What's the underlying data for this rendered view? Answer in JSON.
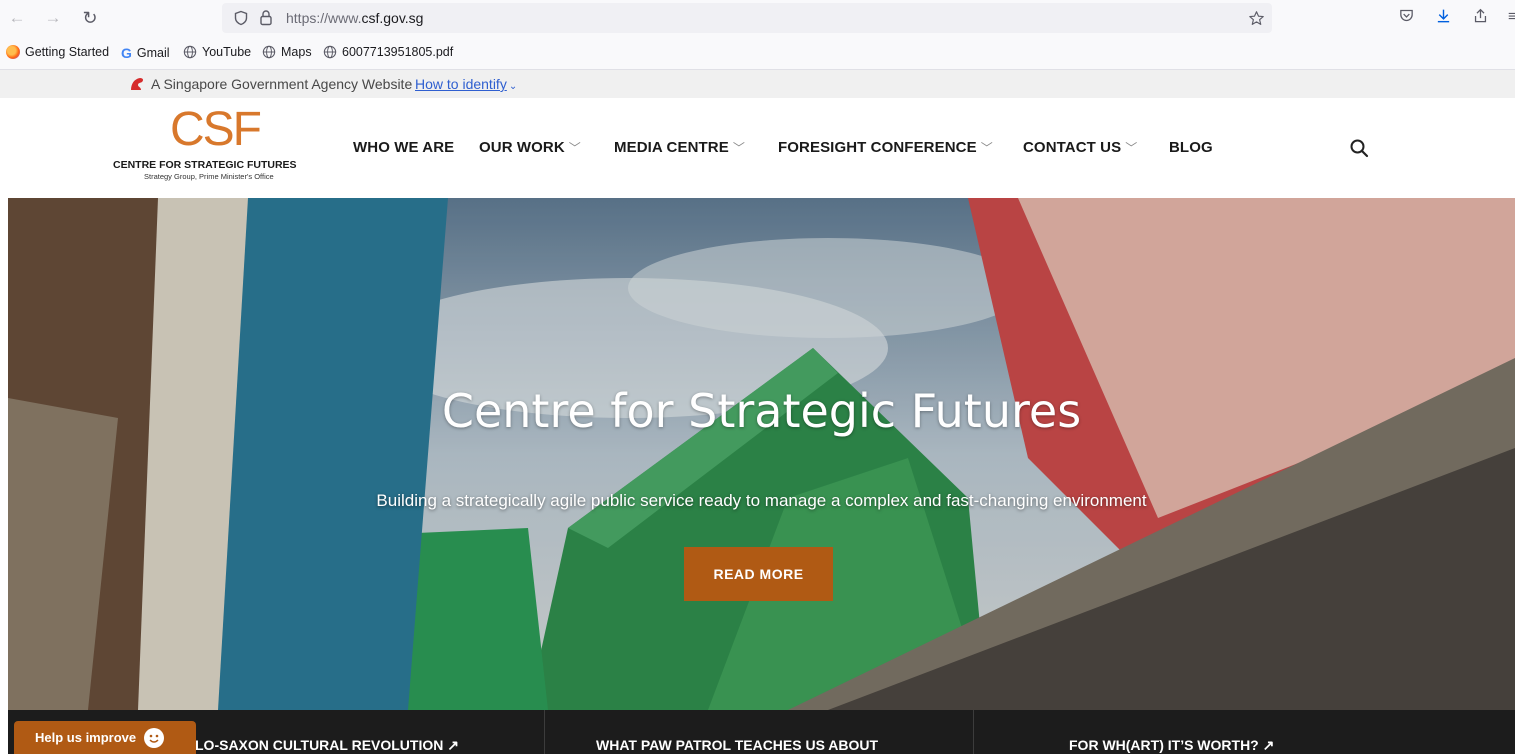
{
  "browser": {
    "url_prefix": "https://www.",
    "url_domain": "csf.gov.sg",
    "bookmarks": [
      "Getting Started",
      "Gmail",
      "YouTube",
      "Maps",
      "6007713951805.pdf"
    ]
  },
  "masthead": {
    "text": "A Singapore Government Agency Website",
    "link": "How to identify"
  },
  "header": {
    "logo_mark": "CSF",
    "logo_title": "CENTRE FOR STRATEGIC FUTURES",
    "logo_subtitle": "Strategy Group, Prime Minister's Office",
    "nav": [
      {
        "label": "WHO WE ARE",
        "chevron": false
      },
      {
        "label": "OUR WORK",
        "chevron": true
      },
      {
        "label": "MEDIA CENTRE",
        "chevron": true
      },
      {
        "label": "FORESIGHT CONFERENCE",
        "chevron": true
      },
      {
        "label": "CONTACT US",
        "chevron": true
      },
      {
        "label": "BLOG",
        "chevron": false
      }
    ]
  },
  "hero": {
    "title": "Centre for Strategic Futures",
    "subtitle": "Building a strategically agile public service ready to manage a complex and fast-changing environment",
    "button": "READ MORE"
  },
  "ticker": {
    "items": [
      "LO-SAXON CULTURAL REVOLUTION ↗",
      "WHAT PAW PATROL TEACHES US ABOUT",
      "FOR WH(ART) IT’S WORTH? ↗"
    ]
  },
  "feedback": {
    "label": "Help us improve"
  },
  "colors": {
    "accent": "#b05a14",
    "logo": "#d8782c",
    "link": "#2f5fd0"
  }
}
